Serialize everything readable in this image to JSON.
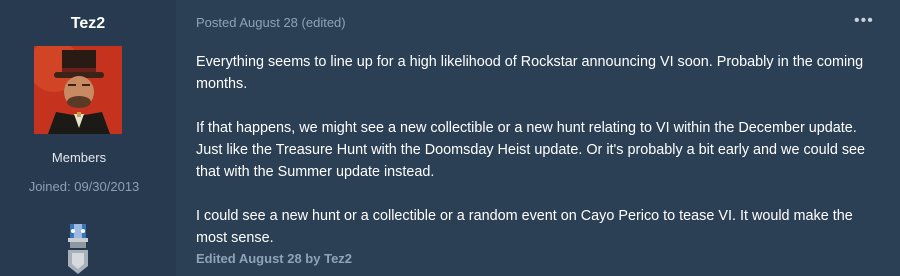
{
  "author": {
    "name": "Tez2",
    "group": "Members",
    "joined": "Joined: 09/30/2013"
  },
  "post": {
    "meta": "Posted August 28 (edited)",
    "menu_icon": "ellipsis-icon",
    "menu_glyph": "•••",
    "paragraphs": [
      "Everything seems to line up for a high likelihood of Rockstar announcing VI soon. Probably in the coming months.",
      "If that happens, we might see a new collectible or a new hunt relating to VI within the December update. Just like the Treasure Hunt with the Doomsday Heist update. Or it's probably a bit early and we could see that with the Summer update instead.",
      "I could see a new hunt or a collectible or a random event on Cayo Perico to tease VI. It would make the most sense."
    ],
    "edited_note": "Edited August 28 by Tez2"
  },
  "colors": {
    "background": "#2b3f55",
    "author_panel": "#273a4f",
    "meta_text": "#8ea3b9",
    "avatar_bg": "#c5331e"
  }
}
